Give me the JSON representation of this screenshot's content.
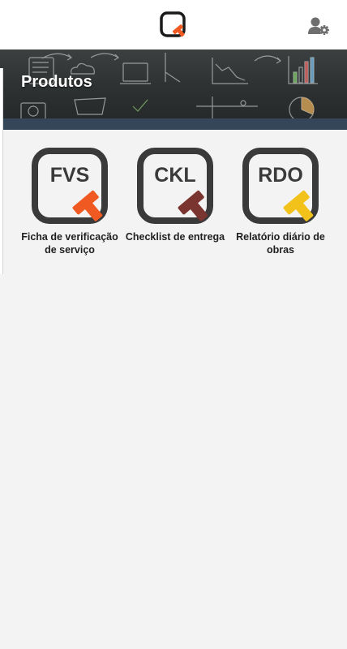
{
  "header": {
    "logo_icon": "app-q-logo-icon",
    "settings_icon": "user-gear-icon"
  },
  "banner": {
    "title": "Produtos",
    "strip_color": "#344658"
  },
  "products": [
    {
      "code": "FVS",
      "label": "Ficha de verificação de serviço",
      "accent": "#f05a22",
      "icon": "fvs-icon"
    },
    {
      "code": "CKL",
      "label": "Checklist de entrega",
      "accent": "#7a3530",
      "icon": "ckl-icon"
    },
    {
      "code": "RDO",
      "label": "Relatório diário de obras",
      "accent": "#f2c21b",
      "icon": "rdo-icon"
    }
  ]
}
